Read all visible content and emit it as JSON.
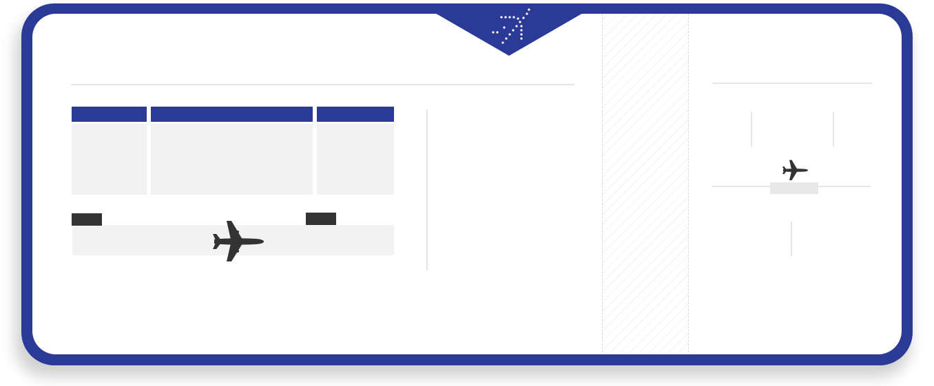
{
  "ticket": {
    "kind": "boarding pass illustration",
    "colors": {
      "frame": "#2b3a96",
      "field_header": "#2b3a96",
      "field_fill": "#f2f2f2",
      "tag": "#333333",
      "plane": "#333333",
      "divider": "#e6e6e6"
    },
    "icons": {
      "header_emblem": "plane-takeoff-dotted-icon",
      "route_plane": "airplane-icon",
      "stub_plane": "airplane-icon"
    },
    "main_fields": {
      "count": 3,
      "labels": [
        "",
        "",
        ""
      ]
    },
    "route_tags": {
      "count": 2,
      "labels": [
        "",
        ""
      ]
    }
  }
}
